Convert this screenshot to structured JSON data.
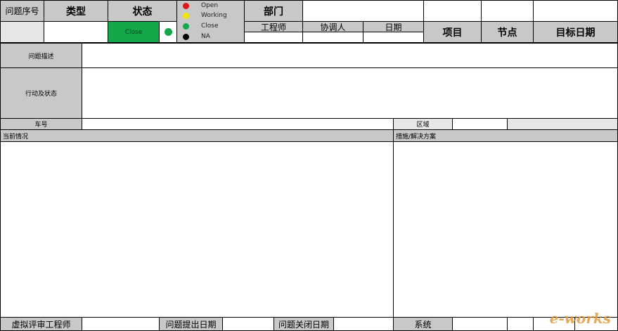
{
  "header": {
    "issue_no_label": "问题序号",
    "type_label": "类型",
    "status_label": "状态",
    "dept_label": "部门",
    "engineer_label": "工程师",
    "assistant_label": "协调人",
    "date_label": "日期",
    "project_label": "项目",
    "node_label": "节点",
    "target_date_label": "目标日期",
    "status_value": "Close",
    "status_color": "#12a84a"
  },
  "legend": [
    {
      "label": "Open",
      "color": "#e0141b"
    },
    {
      "label": "Working",
      "color": "#f3e600"
    },
    {
      "label": "Close",
      "color": "#12a84a"
    },
    {
      "label": "NA",
      "color": "#000000"
    }
  ],
  "sections": {
    "problem_desc_label": "问题描述",
    "action_status_label": "行动及状态",
    "car_no_label": "车号",
    "area_label": "区域",
    "current_situation_label": "当前情况",
    "measures_label": "措施/解决方案"
  },
  "footer": {
    "virtual_review_engineer_label": "虚拟评审工程师",
    "issue_raised_date_label": "问题提出日期",
    "issue_closed_date_label": "问题关闭日期",
    "system_label": "系统"
  },
  "watermark": "e-works"
}
